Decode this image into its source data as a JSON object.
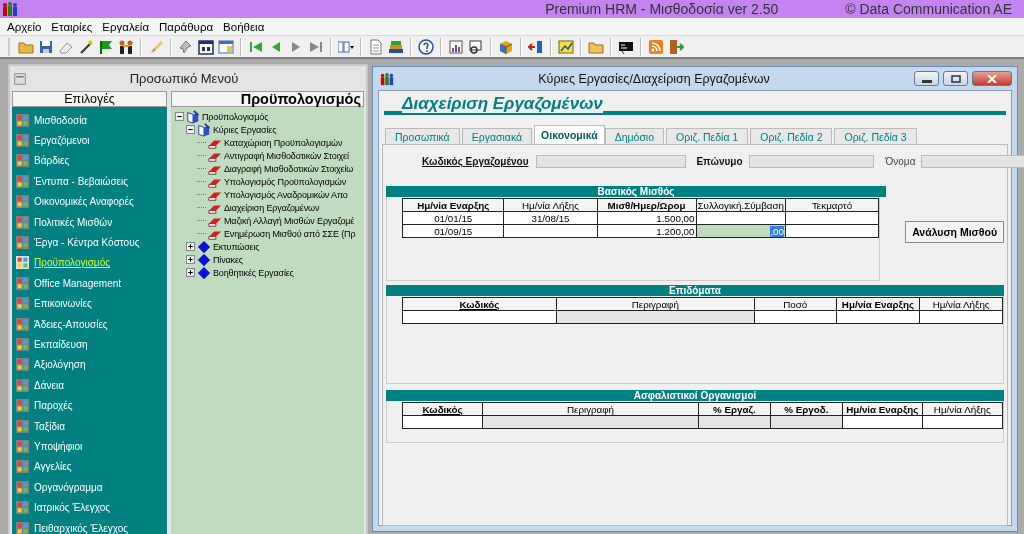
{
  "app": {
    "title": "Premium HRM - Μισθοδοσία ver 2.50",
    "copyright": "© Data Communication AE"
  },
  "menu": [
    "Αρχείο",
    "Εταιρίες",
    "Εργαλεία",
    "Παράθυρα",
    "Βοήθεια"
  ],
  "menu_window": {
    "title": "Προσωπικό Μενού",
    "options_header": "Επιλογές",
    "tree_header": "Προϋπολογισμός",
    "options": [
      {
        "label": "Μισθοδοσία",
        "selected": false
      },
      {
        "label": "Εργαζόμενοι",
        "selected": false
      },
      {
        "label": "Βάρδιες",
        "selected": false
      },
      {
        "label": "Έντυπα - Βεβαιώσεις",
        "selected": false
      },
      {
        "label": "Οικονομικές Αναφορές",
        "selected": false
      },
      {
        "label": "Πολιτικές Μισθών",
        "selected": false
      },
      {
        "label": "Έργα - Κέντρα Κόστους",
        "selected": false
      },
      {
        "label": "Προϋπολογισμός",
        "selected": true
      },
      {
        "label": "Office Management",
        "selected": false
      },
      {
        "label": "Επικοινωνίες",
        "selected": false
      },
      {
        "label": "Άδειες-Απουσίες",
        "selected": false
      },
      {
        "label": "Εκπαίδευση",
        "selected": false
      },
      {
        "label": "Αξιολόγηση",
        "selected": false
      },
      {
        "label": "Δάνεια",
        "selected": false
      },
      {
        "label": "Παροχές",
        "selected": false
      },
      {
        "label": "Ταξίδια",
        "selected": false
      },
      {
        "label": "Υποψήφιοι",
        "selected": false
      },
      {
        "label": "Αγγελίες",
        "selected": false
      },
      {
        "label": "Οργανόγραμμα",
        "selected": false
      },
      {
        "label": "Ιατρικός Έλεγχος",
        "selected": false
      },
      {
        "label": "Πειθαρχικός Έλεγχος",
        "selected": false
      }
    ],
    "tree": [
      {
        "label": "Προϋπολογισμός",
        "kind": "folder",
        "expanded": true,
        "children": [
          {
            "label": "Κύριες Εργασίες",
            "kind": "folder",
            "expanded": true,
            "children": [
              {
                "label": "Καταχώριση Προϋπολογισμών",
                "kind": "task"
              },
              {
                "label": "Αντιγραφή Μισθοδοτικών Στοιχεί",
                "kind": "task"
              },
              {
                "label": "Διαγραφή Μισθοδοτικών Στοιχείω",
                "kind": "task"
              },
              {
                "label": "Υπολογισμός Προϋπολογισμών",
                "kind": "task"
              },
              {
                "label": "Υπολογισμός Αναδρομικών Απο",
                "kind": "task"
              },
              {
                "label": "Διαχείριση Εργαζομένων",
                "kind": "task"
              },
              {
                "label": "Μαζική Αλλαγή Μισθών Εργαζομέ",
                "kind": "task"
              },
              {
                "label": "Ενημέρωση Μισθού από ΣΣΕ (Πρ",
                "kind": "task"
              }
            ]
          },
          {
            "label": "Εκτυπώσεις",
            "kind": "group",
            "expanded": false
          },
          {
            "label": "Πίνακες",
            "kind": "group",
            "expanded": false
          },
          {
            "label": "Βοηθητικές Εργασίες",
            "kind": "group",
            "expanded": false
          }
        ]
      }
    ]
  },
  "employee_window": {
    "title": "Κύριες Εργασίες/Διαχείριση Εργαζομένων",
    "heading": "Διαχείριση Εργαζομένων",
    "tabs": [
      {
        "label": "Προσωπικά",
        "selected": false
      },
      {
        "label": "Εργασιακά",
        "selected": false
      },
      {
        "label": "Οικονομικά",
        "selected": true
      },
      {
        "label": "Δημόσιο",
        "selected": false
      },
      {
        "label": "Οριζ. Πεδία 1",
        "selected": false
      },
      {
        "label": "Οριζ. Πεδία 2",
        "selected": false
      },
      {
        "label": "Οριζ. Πεδία 3",
        "selected": false
      }
    ],
    "fields": [
      {
        "label": "Κωδικός Εργαζομένου",
        "disabled": true
      },
      {
        "label": "Επώνυμο",
        "disabled": true
      },
      {
        "label": "Όνομα",
        "disabled": true
      }
    ],
    "sections": [
      {
        "title": "Βασικός Μισθός",
        "kind": "salary",
        "button": "Ανάλυση Μισθού",
        "columns": [
          {
            "label": "Ημ/νία Εναρξης"
          },
          {
            "label": "Ημ/νία Λήξης"
          },
          {
            "label": "Μισθ/Ημερ/Ωρομ"
          },
          {
            "label": "Συλλογική.Σύμβαση"
          },
          {
            "label": "Τεκμαρτό"
          }
        ],
        "rows": [
          {
            "cells": [
              {
                "text": "01/01/15",
                "editing": false
              },
              {
                "text": "31/08/15",
                "editing": false
              },
              {
                "text": "1.500,00",
                "editing": false
              },
              {
                "text": "",
                "editing": false
              },
              {
                "text": "",
                "editing": false
              }
            ]
          },
          {
            "cells": [
              {
                "text": "01/09/15",
                "editing": false
              },
              {
                "text": "",
                "editing": false
              },
              {
                "text": "1.200,00",
                "editing": false
              },
              {
                "text": ",00",
                "editing": true
              },
              {
                "text": "",
                "editing": false
              }
            ]
          }
        ]
      },
      {
        "title": "Επιδόματα",
        "kind": "list",
        "columns": [
          {
            "label": "Κωδικός",
            "readonly": false
          },
          {
            "label": "Περιγραφή",
            "readonly": true
          },
          {
            "label": "Ποσό",
            "readonly": false
          },
          {
            "label": "Ημ/νία Εναρξης",
            "readonly": false
          },
          {
            "label": "Ημ/νία Λήξης",
            "readonly": false
          }
        ]
      },
      {
        "title": "Ασφαλιστικοί Οργανισμοί",
        "kind": "list",
        "columns": [
          {
            "label": "Κωδικός",
            "readonly": false
          },
          {
            "label": "Περιγραφή",
            "readonly": true
          },
          {
            "label": "% Εργαζ.",
            "readonly": true
          },
          {
            "label": "% Εργοδ.",
            "readonly": true
          },
          {
            "label": "Ημ/νία Εναρξης",
            "readonly": false
          },
          {
            "label": "Ημ/νία Λήξης",
            "readonly": false
          }
        ]
      }
    ]
  }
}
